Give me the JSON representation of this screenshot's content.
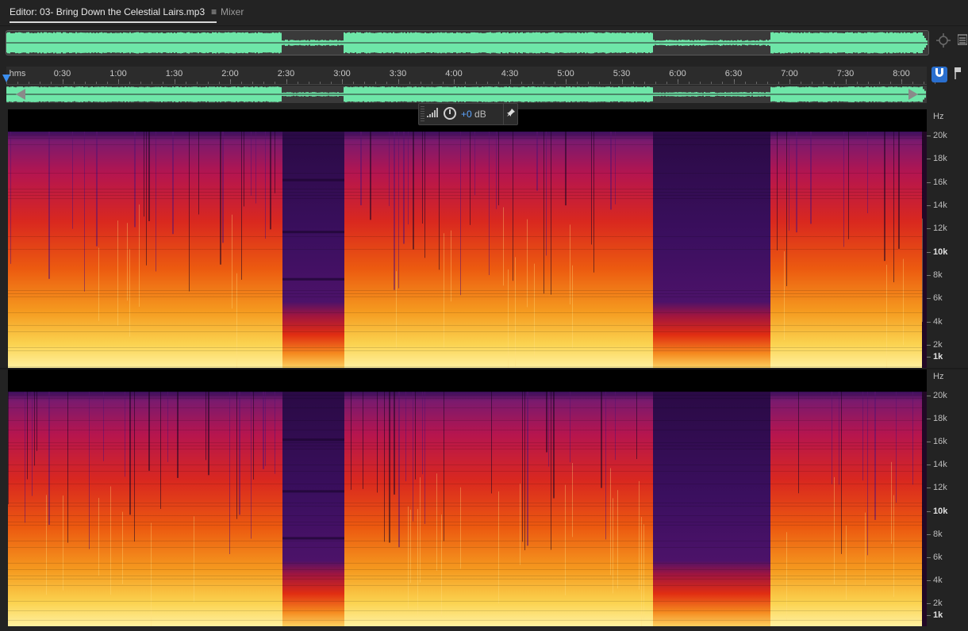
{
  "tabs": {
    "editor_label": "Editor: 03- Bring Down the Celestial Lairs.mp3",
    "editor_menu": "≡",
    "mixer_label": "Mixer"
  },
  "colors": {
    "waveform": "#6ee6a8",
    "waveform_dark": "#2c3d33",
    "accent": "#2a6fcf",
    "hud_value": "#5ea5ff"
  },
  "ruler": {
    "unit_label": "hms",
    "ticks": [
      "0:30",
      "1:00",
      "1:30",
      "2:00",
      "2:30",
      "3:00",
      "3:30",
      "4:00",
      "4:30",
      "5:00",
      "5:30",
      "6:00",
      "6:30",
      "7:00",
      "7:30",
      "8:00"
    ]
  },
  "hud": {
    "gain_value": "+0",
    "gain_unit": " dB"
  },
  "freq_axis": {
    "unit": "Hz",
    "labels": [
      "20k",
      "18k",
      "16k",
      "14k",
      "12k",
      "10k",
      "8k",
      "6k",
      "4k",
      "2k",
      "1k"
    ]
  },
  "quiet_sections": [
    {
      "start": "2:30",
      "end": "3:00"
    },
    {
      "start": "5:45",
      "end": "6:45"
    }
  ],
  "icons": {
    "zoom_tool": "target-icon",
    "panel_menu": "panel-menu-icon",
    "snap": "snap-magnet-icon",
    "marker": "marker-pin-icon",
    "pin": "pin-icon",
    "knob": "gain-knob-icon"
  }
}
